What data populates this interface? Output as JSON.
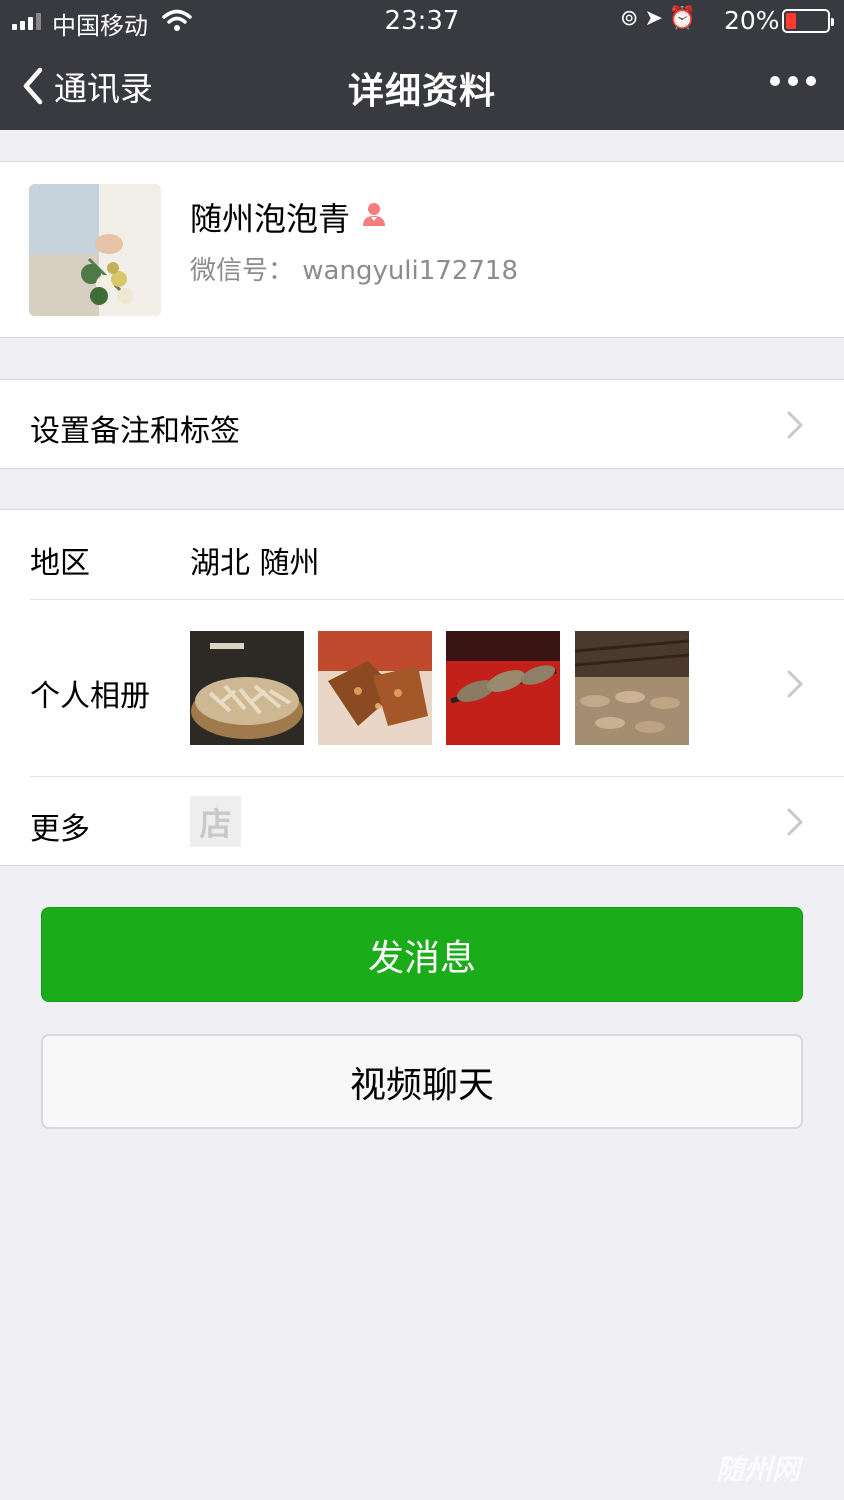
{
  "status_bar": {
    "carrier": "中国移动",
    "time": "23:37",
    "battery_percent": "20%",
    "battery_level": 0.2,
    "icons": [
      "orientation-lock-icon",
      "location-arrow-icon",
      "alarm-icon"
    ]
  },
  "nav": {
    "back_label": "通讯录",
    "title": "详细资料",
    "more_icon": "more-dots-icon"
  },
  "profile": {
    "name": "随州泡泡青",
    "wxid": "微信号： wangyuli172718",
    "gender_icon": "female-icon",
    "gender_color": "#f37e7d"
  },
  "remark": {
    "label": "设置备注和标签"
  },
  "details": {
    "region_label": "地区",
    "region_value": "湖北 随州",
    "album_label": "个人相册",
    "album_photos": 4,
    "more_label": "更多",
    "shop_glyph": "店"
  },
  "actions": {
    "send_message": "发消息",
    "video_chat": "视频聊天"
  },
  "colors": {
    "nav_bg": "#393a3f",
    "page_bg": "#efeff4",
    "primary_green": "#1aad19"
  },
  "watermark": "随州网"
}
